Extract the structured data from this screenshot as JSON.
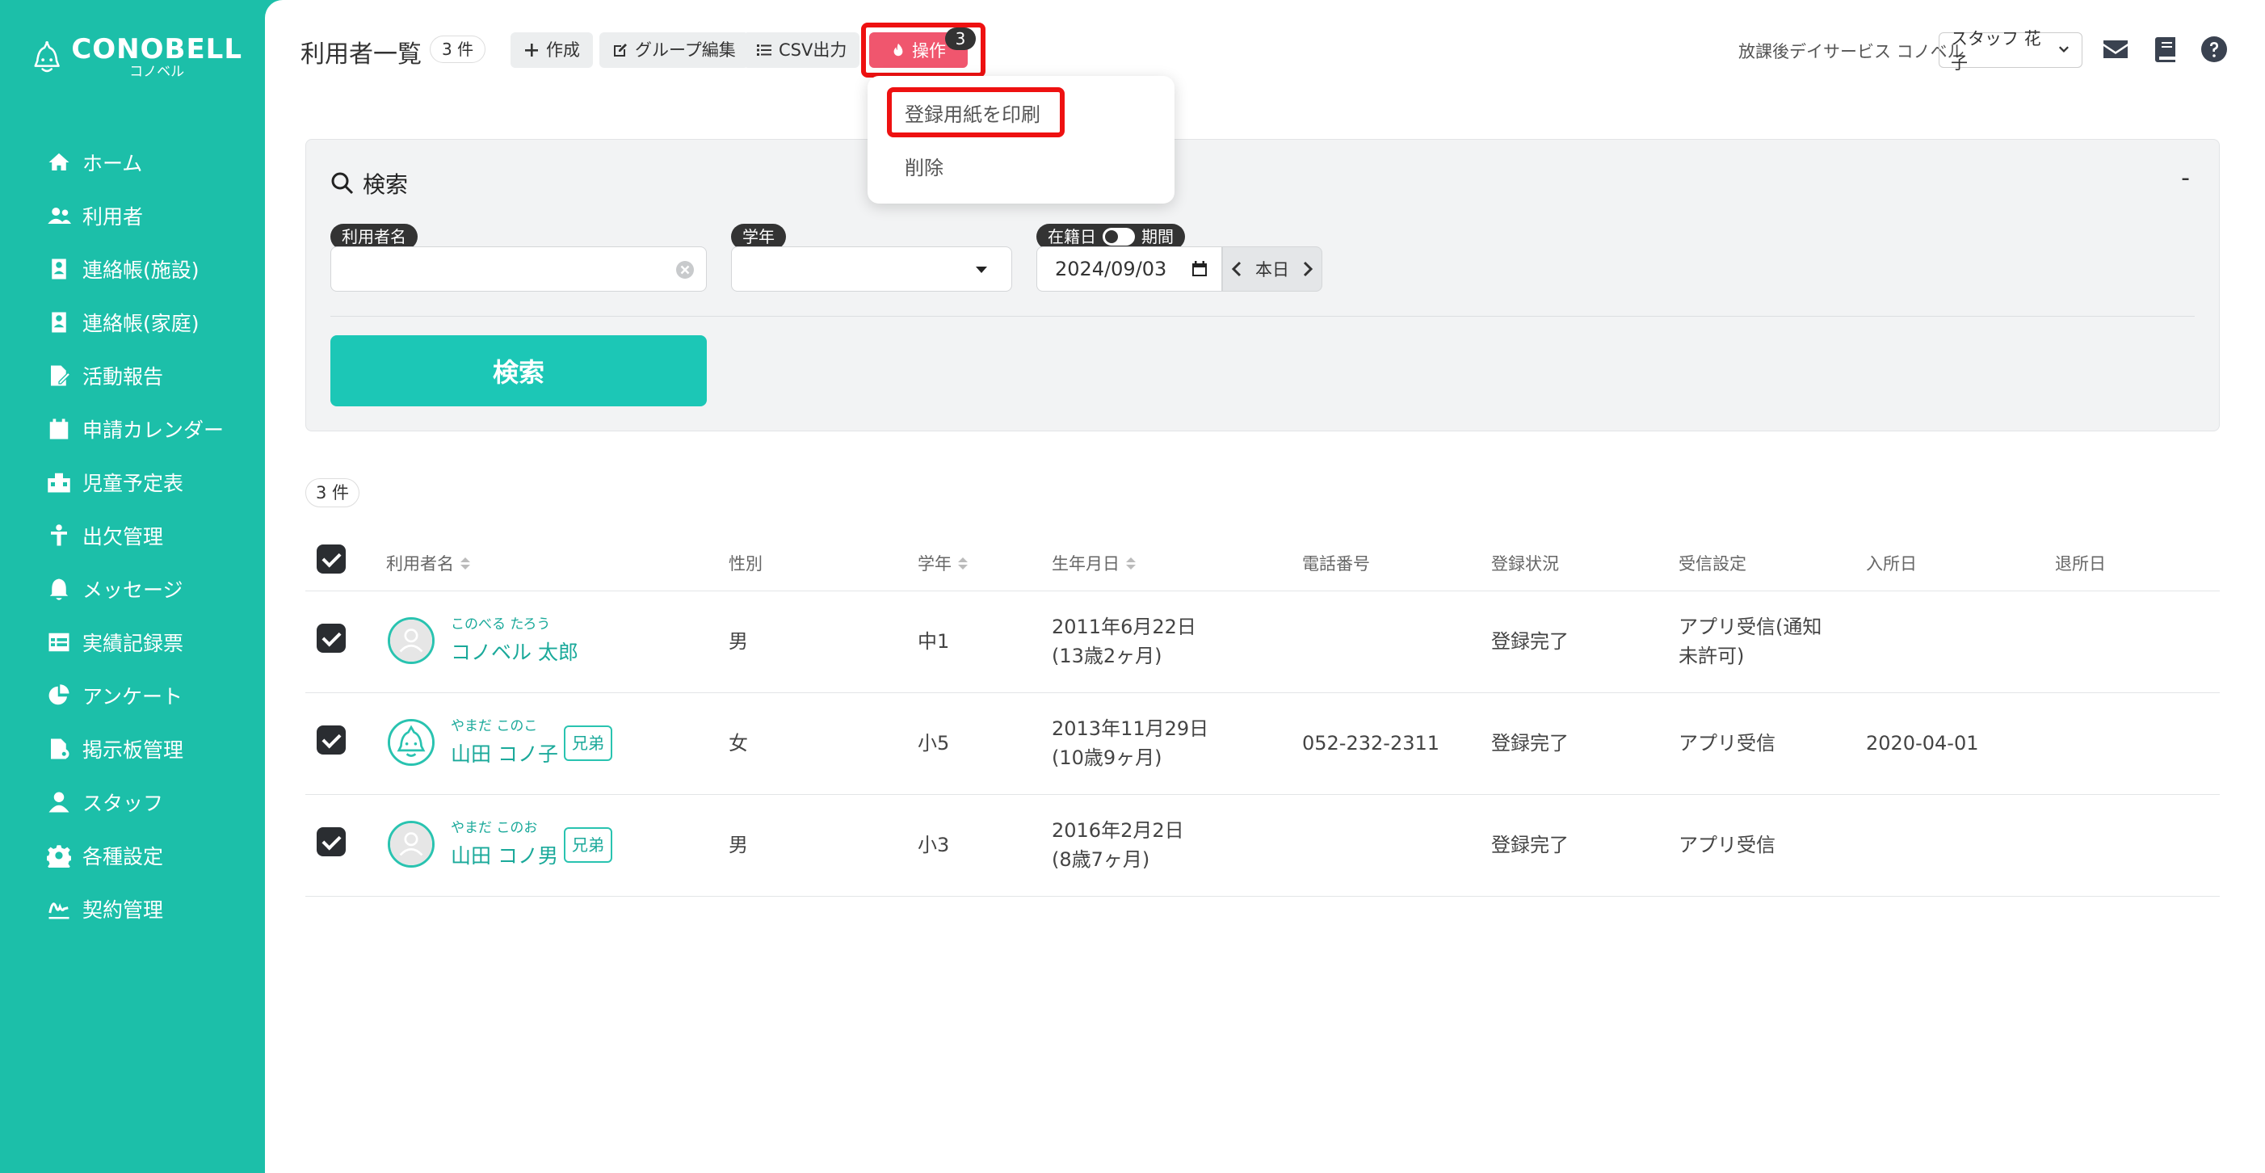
{
  "brand": {
    "name": "CONOBELL",
    "sub": "コノベル"
  },
  "sidebar": {
    "items": [
      {
        "label": "ホーム",
        "icon": "home-icon"
      },
      {
        "label": "利用者",
        "icon": "users-icon"
      },
      {
        "label": "連絡帳(施設)",
        "icon": "contact-book-icon"
      },
      {
        "label": "連絡帳(家庭)",
        "icon": "contact-book-icon"
      },
      {
        "label": "活動報告",
        "icon": "report-icon"
      },
      {
        "label": "申請カレンダー",
        "icon": "calendar-icon"
      },
      {
        "label": "児童予定表",
        "icon": "schedule-icon"
      },
      {
        "label": "出欠管理",
        "icon": "attendance-icon"
      },
      {
        "label": "メッセージ",
        "icon": "bell-icon"
      },
      {
        "label": "実績記録票",
        "icon": "table-icon"
      },
      {
        "label": "アンケート",
        "icon": "pie-chart-icon"
      },
      {
        "label": "掲示板管理",
        "icon": "board-icon"
      },
      {
        "label": "スタッフ",
        "icon": "staff-icon"
      },
      {
        "label": "各種設定",
        "icon": "gear-icon"
      },
      {
        "label": "契約管理",
        "icon": "signature-icon"
      }
    ]
  },
  "header": {
    "title": "利用者一覧",
    "count": "3 件",
    "create_label": "作成",
    "group_edit_label": "グループ編集",
    "csv_label": "CSV出力",
    "operation_label": "操作",
    "operation_badge": "3",
    "facility": "放課後デイサービス コノベル",
    "staff": "スタッフ 花子"
  },
  "dropdown": {
    "print_label": "登録用紙を印刷",
    "delete_label": "削除"
  },
  "search": {
    "title": "検索",
    "collapse": "-",
    "name_label": "利用者名",
    "name_value": "",
    "grade_label": "学年",
    "grade_value": "",
    "enrolled_label": "在籍日",
    "period_label": "期間",
    "date_value": "2024/09/03",
    "today_label": "本日",
    "button": "検索"
  },
  "results": {
    "count": "3 件",
    "columns": {
      "name": "利用者名",
      "gender": "性別",
      "grade": "学年",
      "birthday": "生年月日",
      "phone": "電話番号",
      "status": "登録状況",
      "receive": "受信設定",
      "enter": "入所日",
      "leave": "退所日"
    },
    "rows": [
      {
        "kana": "このべる たろう",
        "name": "コノベル 太郎",
        "sibling": "",
        "gender": "男",
        "grade": "中1",
        "birth1": "2011年6月22日",
        "birth2": "(13歳2ヶ月)",
        "phone": "",
        "status": "登録完了",
        "receive1": "アプリ受信(通知",
        "receive2": "未許可)",
        "enter": "",
        "leave": ""
      },
      {
        "kana": "やまだ このこ",
        "name": "山田 コノ子",
        "sibling": "兄弟",
        "gender": "女",
        "grade": "小5",
        "birth1": "2013年11月29日",
        "birth2": "(10歳9ヶ月)",
        "phone": "052-232-2311",
        "status": "登録完了",
        "receive1": "アプリ受信",
        "receive2": "",
        "enter": "2020-04-01",
        "leave": ""
      },
      {
        "kana": "やまだ このお",
        "name": "山田 コノ男",
        "sibling": "兄弟",
        "gender": "男",
        "grade": "小3",
        "birth1": "2016年2月2日",
        "birth2": "(8歳7ヶ月)",
        "phone": "",
        "status": "登録完了",
        "receive1": "アプリ受信",
        "receive2": "",
        "enter": "",
        "leave": ""
      }
    ]
  },
  "colors": {
    "brand": "#1cbfa9",
    "operation": "#f0566e",
    "highlight": "#ee1111"
  }
}
